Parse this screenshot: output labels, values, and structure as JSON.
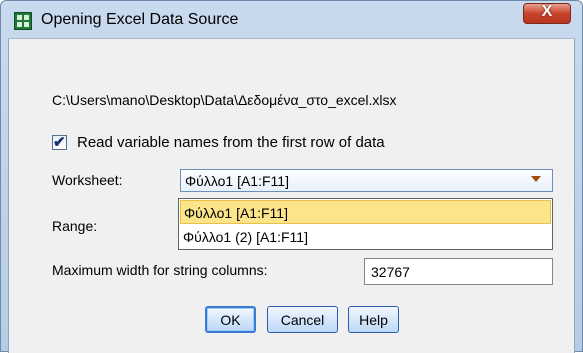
{
  "window": {
    "title": "Opening Excel Data Source",
    "close_label": "X"
  },
  "file_path": "C:\\Users\\mano\\Desktop\\Data\\Δεδομένα_στο_excel.xlsx",
  "read_names": {
    "label": "Read variable names from the first row of data",
    "checked": true,
    "mark": "✔"
  },
  "worksheet": {
    "label": "Worksheet:",
    "selected": "Φύλλο1 [A1:F11]",
    "options": [
      "Φύλλο1 [A1:F11]",
      "Φύλλο1 (2) [A1:F11]"
    ]
  },
  "range": {
    "label": "Range:"
  },
  "max_width": {
    "label": "Maximum width for string columns:",
    "value": "32767"
  },
  "buttons": {
    "ok": "OK",
    "cancel": "Cancel",
    "help": "Help"
  }
}
